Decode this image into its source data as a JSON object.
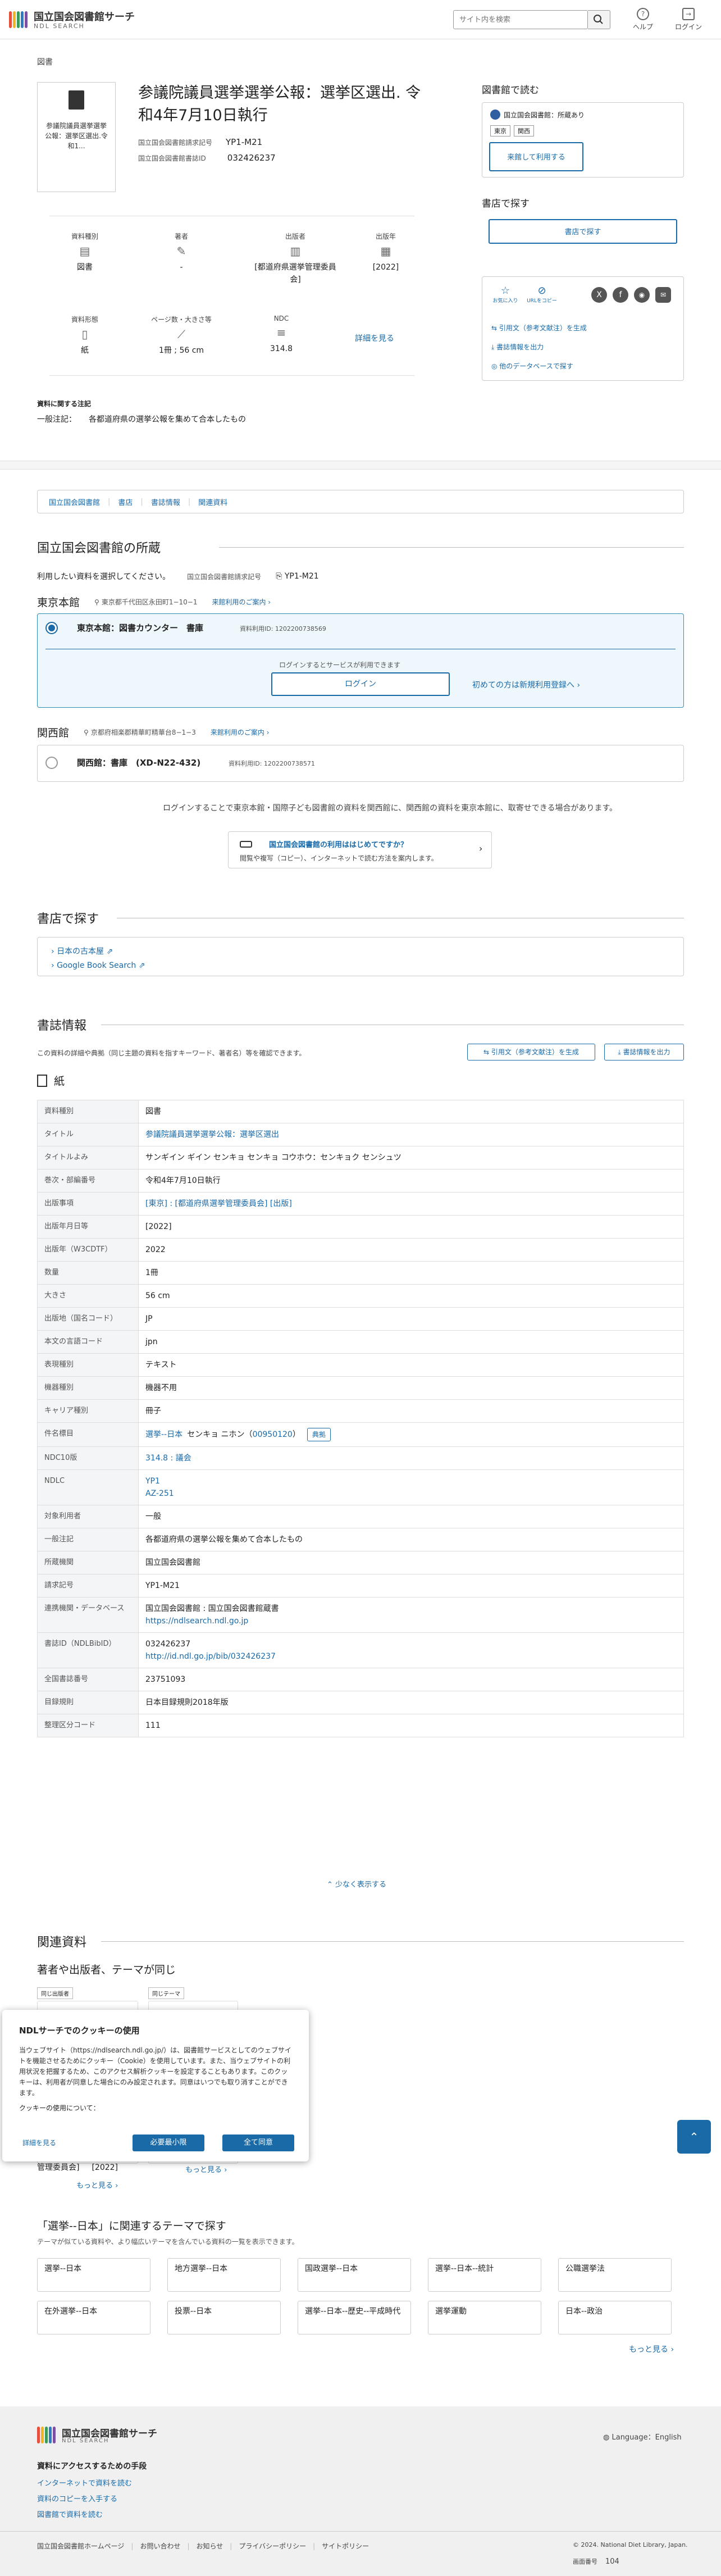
{
  "header": {
    "logo_jp": "国立国会図書館サーチ",
    "logo_en": "NDL SEARCH",
    "search_placeholder": "サイト内を検索",
    "help": "ヘルプ",
    "login": "ログイン"
  },
  "breadcrumb": "図書",
  "item": {
    "thumb_text": "参議院議員選挙選挙公報：選挙区選出.令和1...",
    "title": "参議院議員選挙選挙公報：選挙区選出. 令和4年7月10日執行",
    "callno_label": "国立国会図書館請求記号",
    "callno": "YP1-M21",
    "bibid_label": "国立国会図書館書誌ID",
    "bibid": "032426237",
    "facets": [
      {
        "label": "資料種別",
        "value": "図書",
        "icon": "book-icon"
      },
      {
        "label": "著者",
        "value": "-",
        "icon": "pen-icon"
      },
      {
        "label": "出版者",
        "value": "[都道府県選挙管理委員会]",
        "icon": "building-icon"
      },
      {
        "label": "出版年",
        "value": "[2022]",
        "icon": "calendar-icon"
      },
      {
        "label": "資料形態",
        "value": "紙",
        "icon": "paper-icon"
      },
      {
        "label": "ページ数・大きさ等",
        "value": "1冊 ; 56 cm",
        "icon": "ruler-icon"
      },
      {
        "label": "NDC",
        "value": "314.8",
        "icon": "list-icon"
      }
    ],
    "detail_link": "詳細を見る",
    "note_heading": "資料に関する注記",
    "note_label": "一般注記：",
    "note_value": "各都道府県の選挙公報を集めて合本したもの"
  },
  "side": {
    "read_title": "図書館で読む",
    "ndl_badge": "国立国会図書館：所蔵あり",
    "tag1": "東京",
    "tag2": "関西",
    "request_btn": "来館して利用する",
    "shop_title": "書店で探す",
    "shop_btn": "書店で探す",
    "share_label": "お気に入り",
    "copy_label": "URLをコピー",
    "cite_link": "引用文（参考文献注）を生成",
    "export_link": "書誌情報を出力",
    "other_db_link": "他のデータベースで探す"
  },
  "tabs": [
    "国立国会図書館",
    "書店",
    "書誌情報",
    "関連資料"
  ],
  "holdings": {
    "title": "国立国会図書館の所蔵",
    "instruction": "利用したい資料を選択してください。",
    "callno_label": "国立国会図書館請求記号",
    "callno": "YP1-M21",
    "tokyo": "東京本館",
    "tokyo_addr": "東京都千代田区永田町1−10−1",
    "guide": "来館利用のご案内",
    "tokyo_loc": "東京本館：図書カウンター　書庫",
    "tokyo_id": "資料利用ID: 1202200738569",
    "login_note": "ログインするとサービスが利用できます",
    "login_btn": "ログイン",
    "register": "初めての方は新規利用登録へ",
    "kansai": "関西館",
    "kansai_addr": "京都府相楽郡精華町精華台8−1−3",
    "kansai_loc": "関西館：書庫　(XD-N22-432)",
    "kansai_id": "資料利用ID: 1202200738571",
    "transfer_note": "ログインすることで東京本館・国際子ども図書館の資料を関西館に、関西館の資料を東京本館に、取寄せできる場合があります。",
    "first_time_title": "国立国会図書館の利用ははじめてですか？",
    "first_time_sub": "閲覧や複写（コピー）、インターネットで読む方法を案内します。"
  },
  "shops": {
    "title": "書店で探す",
    "links": [
      "日本の古本屋",
      "Google Book Search"
    ]
  },
  "bib": {
    "title": "書誌情報",
    "desc": "この資料の詳細や典拠（同じ主題の資料を指すキーワード、著者名）等を確認できます。",
    "cite_btn": "引用文（参考文献注）を生成",
    "export_btn": "書誌情報を出力",
    "format": "紙",
    "rows": [
      {
        "k": "資料種別",
        "v": "図書"
      },
      {
        "k": "タイトル",
        "v": "参議院議員選挙選挙公報：選挙区選出",
        "link": true
      },
      {
        "k": "タイトルよみ",
        "v": "サンギイン ギイン センキョ センキョ コウホウ：センキョク センシュツ"
      },
      {
        "k": "巻次・部編番号",
        "v": "令和4年7月10日執行"
      },
      {
        "k": "出版事項",
        "v": "[東京] : [都道府県選挙管理委員会] [出版]",
        "link": true
      },
      {
        "k": "出版年月日等",
        "v": "[2022]"
      },
      {
        "k": "出版年（W3CDTF）",
        "v": "2022"
      },
      {
        "k": "数量",
        "v": "1冊"
      },
      {
        "k": "大きさ",
        "v": "56 cm"
      },
      {
        "k": "出版地（国名コード）",
        "v": "JP"
      },
      {
        "k": "本文の言語コード",
        "v": "jpn"
      },
      {
        "k": "表現種別",
        "v": "テキスト"
      },
      {
        "k": "機器種別",
        "v": "機器不用"
      },
      {
        "k": "キャリア種別",
        "v": "冊子"
      },
      {
        "k": "件名標目",
        "v": "選挙--日本",
        "v2": "センキョ ニホン（",
        "v3": "00950120",
        "v4": "）",
        "pill": "典拠"
      },
      {
        "k": "NDC10版",
        "v": "314.8 : 議会",
        "link": true
      },
      {
        "k": "NDLC",
        "v": "YP1",
        "v2": "AZ-251",
        "link": true
      },
      {
        "k": "対象利用者",
        "v": "一般"
      },
      {
        "k": "一般注記",
        "v": "各都道府県の選挙公報を集めて合本したもの"
      },
      {
        "k": "所蔵機関",
        "v": "国立国会図書館"
      },
      {
        "k": "請求記号",
        "v": "YP1-M21"
      },
      {
        "k": "連携機関・データベース",
        "v": "国立国会図書館 : 国立国会図書館蔵書",
        "v2": "https://ndlsearch.ndl.go.jp"
      },
      {
        "k": "書誌ID（NDLBibID）",
        "v": "032426237",
        "v2": "http://id.ndl.go.jp/bib/032426237"
      },
      {
        "k": "全国書誌番号",
        "v": "23751093"
      },
      {
        "k": "目録規則",
        "v": "日本目録規則2018年版"
      },
      {
        "k": "整理区分コード",
        "v": "111"
      }
    ],
    "less": "少なく表示する"
  },
  "related": {
    "title": "関連資料",
    "sub": "著者や出版者、テーマが同じ",
    "tag1": "同じ出版者",
    "tag2": "同じテーマ",
    "pub_text": "管理委員会]",
    "pub_year": "[2022]",
    "more1": "もっと見る",
    "more2": "もっと見る",
    "theme_title": "「選挙--日本」に関連するテーマで探す",
    "theme_sub": "テーマが似ている資料や、より幅広いテーマを含んでいる資料の一覧を表示できます。",
    "themes": [
      "選挙--日本",
      "地方選挙--日本",
      "国政選挙--日本",
      "選挙--日本--統計",
      "公職選挙法",
      "在外選挙--日本",
      "投票--日本",
      "選挙--日本--歴史--平成時代",
      "選挙運動",
      "日本--政治"
    ],
    "theme_more": "もっと見る"
  },
  "cookie": {
    "title": "NDLサーチでのクッキーの使用",
    "body": "当ウェブサイト（https://ndlsearch.ndl.go.jp/）は、図書館サービスとしてのウェブサイトを機能させるためにクッキー（Cookie）を使用しています。また、当ウェブサイトの利用状況を把握するため、このアクセス解析クッキーを設定することもあります。このクッキーは、利用者が同意した場合にのみ設定されます。同意はいつでも取り消すことができます。",
    "usage": "クッキーの使用について：",
    "details": "詳細を見る",
    "necessary": "必要最小限",
    "accept": "全て同意"
  },
  "footer": {
    "logo_jp": "国立国会図書館サーチ",
    "logo_en": "NDL SEARCH",
    "language": "Language：English",
    "access_title": "資料にアクセスするための手段",
    "links": [
      "インターネットで資料を読む",
      "資料のコピーを入手する",
      "図書館で資料を読む"
    ],
    "bottom": [
      "国立国会図書館ホームページ",
      "お問い合わせ",
      "お知らせ",
      "プライバシーポリシー",
      "サイトポリシー"
    ],
    "copyright": "© 2024. National Diet Library, Japan.",
    "version_label": "画面番号",
    "version": "104"
  }
}
